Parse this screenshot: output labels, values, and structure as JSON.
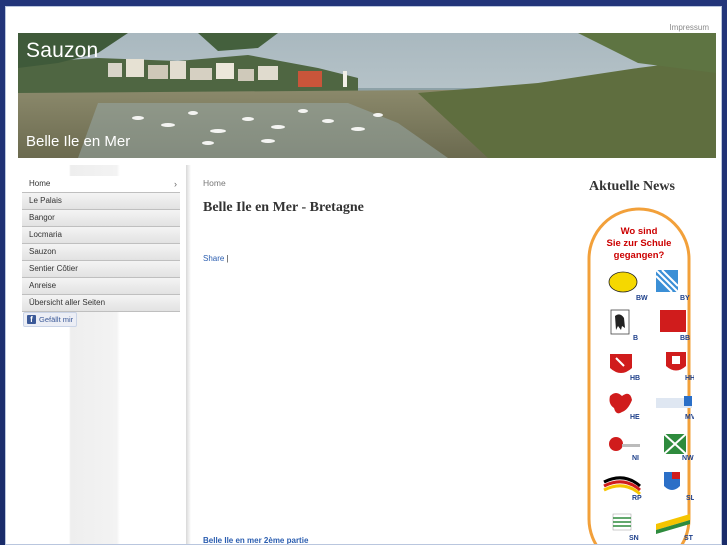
{
  "header": {
    "impressum": "Impressum",
    "site_title": "Sauzon",
    "site_subtitle": "Belle Ile en Mer"
  },
  "nav": {
    "items": [
      {
        "label": "Home",
        "active": true
      },
      {
        "label": "Le Palais"
      },
      {
        "label": "Bangor"
      },
      {
        "label": "Locmaria"
      },
      {
        "label": "Sauzon"
      },
      {
        "label": "Sentier Côtier"
      },
      {
        "label": "Anreise"
      },
      {
        "label": "Übersicht aller Seiten"
      }
    ],
    "chevron": "›"
  },
  "facebook": {
    "label": "Gefällt mir",
    "icon": "f"
  },
  "main": {
    "breadcrumb": "Home",
    "heading": "Belle Ile en Mer - Bretagne",
    "share": "Share",
    "share_sep": "|",
    "bottom_link": "Belle Ile en mer 2ème partie"
  },
  "sidebar": {
    "news_title": "Aktuelle News",
    "ad": {
      "line1": "Wo sind",
      "line2": "Sie zur Schule",
      "line3": "gegangen?",
      "states": [
        "BW",
        "BY",
        "B",
        "BB",
        "HB",
        "HH",
        "HE",
        "MV",
        "NI",
        "NW",
        "RP",
        "SL",
        "SN",
        "ST"
      ],
      "border_color": "#f2a03a",
      "text_color": "#cc0000",
      "code_color": "#1d3f8a"
    }
  }
}
